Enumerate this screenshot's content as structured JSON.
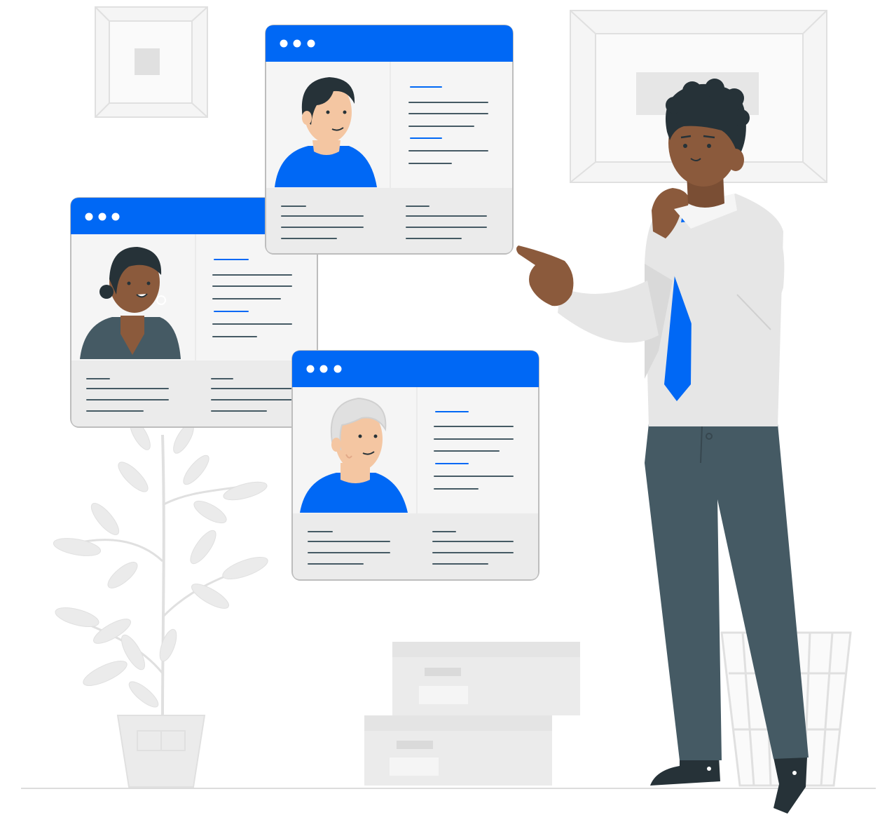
{
  "colors": {
    "accent": "#0068f5",
    "window_border": "#bdbdbd",
    "window_body": "#f5f5f5",
    "window_footer": "#ebebeb",
    "background_decor": "#ebebeb",
    "man_shirt": "#e6e6e6",
    "man_pants": "#455a64",
    "man_skin": "#8b5a3c",
    "dark_hair": "#263238",
    "text_line": "#455a64"
  },
  "profile_cards": [
    {
      "id": "card-young-man",
      "dots": 3,
      "avatar": "young-man-avatar"
    },
    {
      "id": "card-woman",
      "dots": 3,
      "avatar": "woman-avatar"
    },
    {
      "id": "card-older-man",
      "dots": 3,
      "avatar": "older-man-avatar"
    }
  ],
  "decor": {
    "icons": [
      "picture-frame-icon",
      "plant-icon",
      "storage-box-icon",
      "wastebasket-icon"
    ]
  }
}
